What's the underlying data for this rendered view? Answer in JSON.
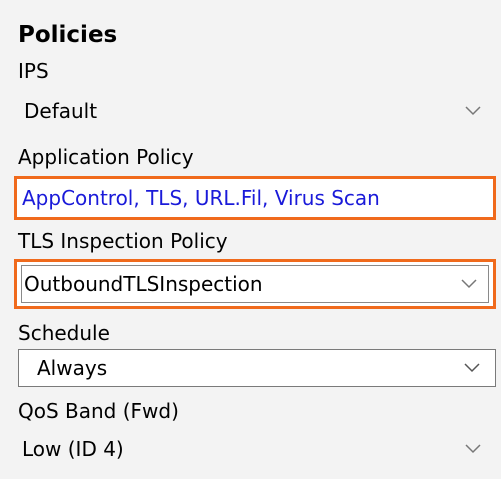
{
  "policies": {
    "heading": "Policies",
    "ips": {
      "label": "IPS",
      "value": "Default"
    },
    "application_policy": {
      "label": "Application Policy",
      "value": "AppControl, TLS, URL.Fil, Virus Scan"
    },
    "tls_inspection": {
      "label": "TLS Inspection Policy",
      "value": "OutboundTLSInspection"
    },
    "schedule": {
      "label": "Schedule",
      "value": "Always"
    },
    "qos_band": {
      "label": "QoS Band (Fwd)",
      "value": "Low (ID 4)"
    }
  },
  "colors": {
    "highlight": "#f06a1c",
    "link": "#1a1ad9",
    "panel_bg": "#f3f3f3"
  },
  "icons": {
    "dropdown": "chevron-down-icon"
  }
}
